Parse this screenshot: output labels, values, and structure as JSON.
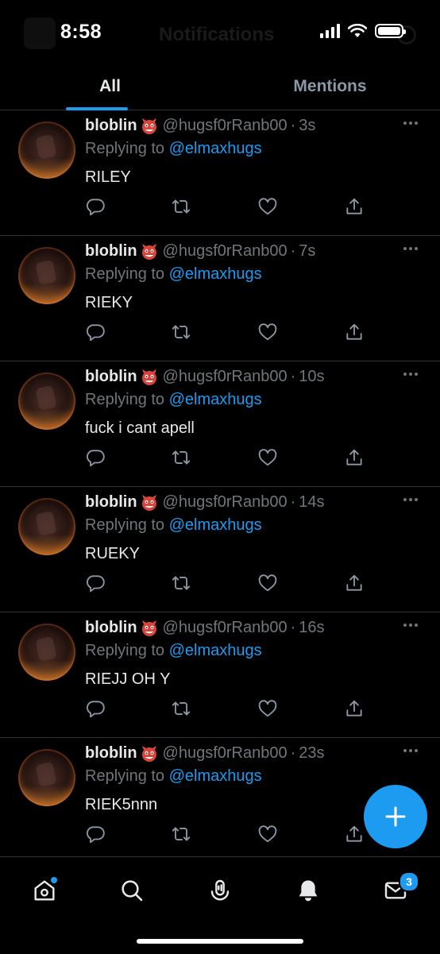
{
  "status_bar": {
    "time": "8:58",
    "background_title": "Notifications",
    "icons": [
      "cellular-signal-icon",
      "wifi-icon",
      "battery-icon"
    ]
  },
  "tabs": [
    {
      "label": "All",
      "selected": true
    },
    {
      "label": "Mentions",
      "selected": false
    }
  ],
  "colors": {
    "accent": "#1d9bf0",
    "background": "#000000",
    "secondary_text": "#71767b",
    "divider": "#2f3336"
  },
  "tweets": [
    {
      "name": "bloblin",
      "emoji": "ogre-emoji",
      "handle": "@hugsf0rRanb00",
      "sep": "·",
      "time": "3s",
      "replying_prefix": "Replying to",
      "replying_to": "@elmaxhugs",
      "text": "RILEY"
    },
    {
      "name": "bloblin",
      "emoji": "ogre-emoji",
      "handle": "@hugsf0rRanb00",
      "sep": "·",
      "time": "7s",
      "replying_prefix": "Replying to",
      "replying_to": "@elmaxhugs",
      "text": "RIEKY"
    },
    {
      "name": "bloblin",
      "emoji": "ogre-emoji",
      "handle": "@hugsf0rRanb00",
      "sep": "·",
      "time": "10s",
      "replying_prefix": "Replying to",
      "replying_to": "@elmaxhugs",
      "text": "fuck i cant apell"
    },
    {
      "name": "bloblin",
      "emoji": "ogre-emoji",
      "handle": "@hugsf0rRanb00",
      "sep": "·",
      "time": "14s",
      "replying_prefix": "Replying to",
      "replying_to": "@elmaxhugs",
      "text": "RUEKY"
    },
    {
      "name": "bloblin",
      "emoji": "ogre-emoji",
      "handle": "@hugsf0rRanb00",
      "sep": "·",
      "time": "16s",
      "replying_prefix": "Replying to",
      "replying_to": "@elmaxhugs",
      "text": "RIEJJ OH Y"
    },
    {
      "name": "bloblin",
      "emoji": "ogre-emoji",
      "handle": "@hugsf0rRanb00",
      "sep": "·",
      "time": "23s",
      "replying_prefix": "Replying to",
      "replying_to": "@elmaxhugs",
      "text": "RIEK5nnn"
    }
  ],
  "tweet_actions": [
    "reply-icon",
    "retweet-icon",
    "like-icon",
    "share-icon"
  ],
  "fab": {
    "icon": "plus-icon"
  },
  "bottom_nav": {
    "items": [
      "home-icon",
      "search-icon",
      "spaces-icon",
      "notifications-icon",
      "messages-icon"
    ],
    "home_unread_dot": true,
    "messages_badge": "3"
  }
}
